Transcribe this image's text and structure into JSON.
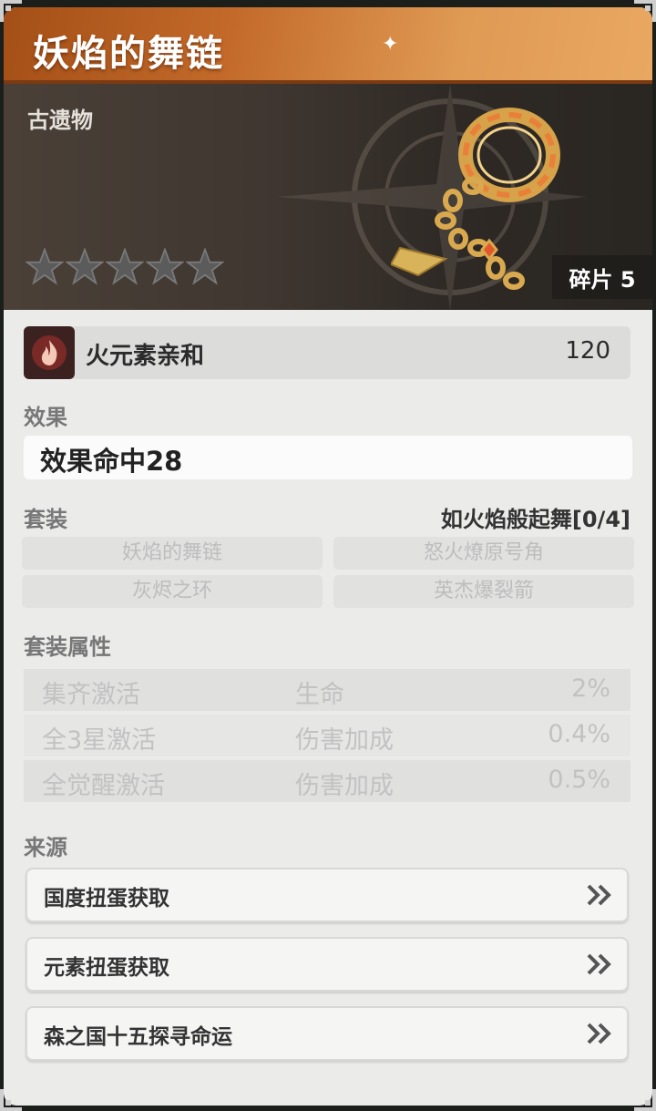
{
  "header": {
    "title": "妖焰的舞链"
  },
  "hero": {
    "category": "古遗物",
    "stars": 5,
    "fragments_label": "碎片 5"
  },
  "affinity": {
    "label": "火元素亲和",
    "value": "120"
  },
  "effect": {
    "section_label": "效果",
    "text": "效果命中28"
  },
  "set": {
    "section_label": "套装",
    "status": "如火焰般起舞[0/4]",
    "pieces": [
      "妖焰的舞链",
      "怒火燎原号角",
      "灰烬之环",
      "英杰爆裂箭"
    ]
  },
  "set_bonus": {
    "section_label": "套装属性",
    "rows": [
      {
        "condition": "集齐激活",
        "stat": "生命",
        "value": "2%"
      },
      {
        "condition": "全3星激活",
        "stat": "伤害加成",
        "value": "0.4%"
      },
      {
        "condition": "全觉醒激活",
        "stat": "伤害加成",
        "value": "0.5%"
      }
    ]
  },
  "source": {
    "section_label": "来源",
    "items": [
      "国度扭蛋获取",
      "元素扭蛋获取",
      "森之国十五探寻命运"
    ]
  },
  "colors": {
    "accent_orange": "#c36a2a",
    "panel": "#ebebea"
  }
}
